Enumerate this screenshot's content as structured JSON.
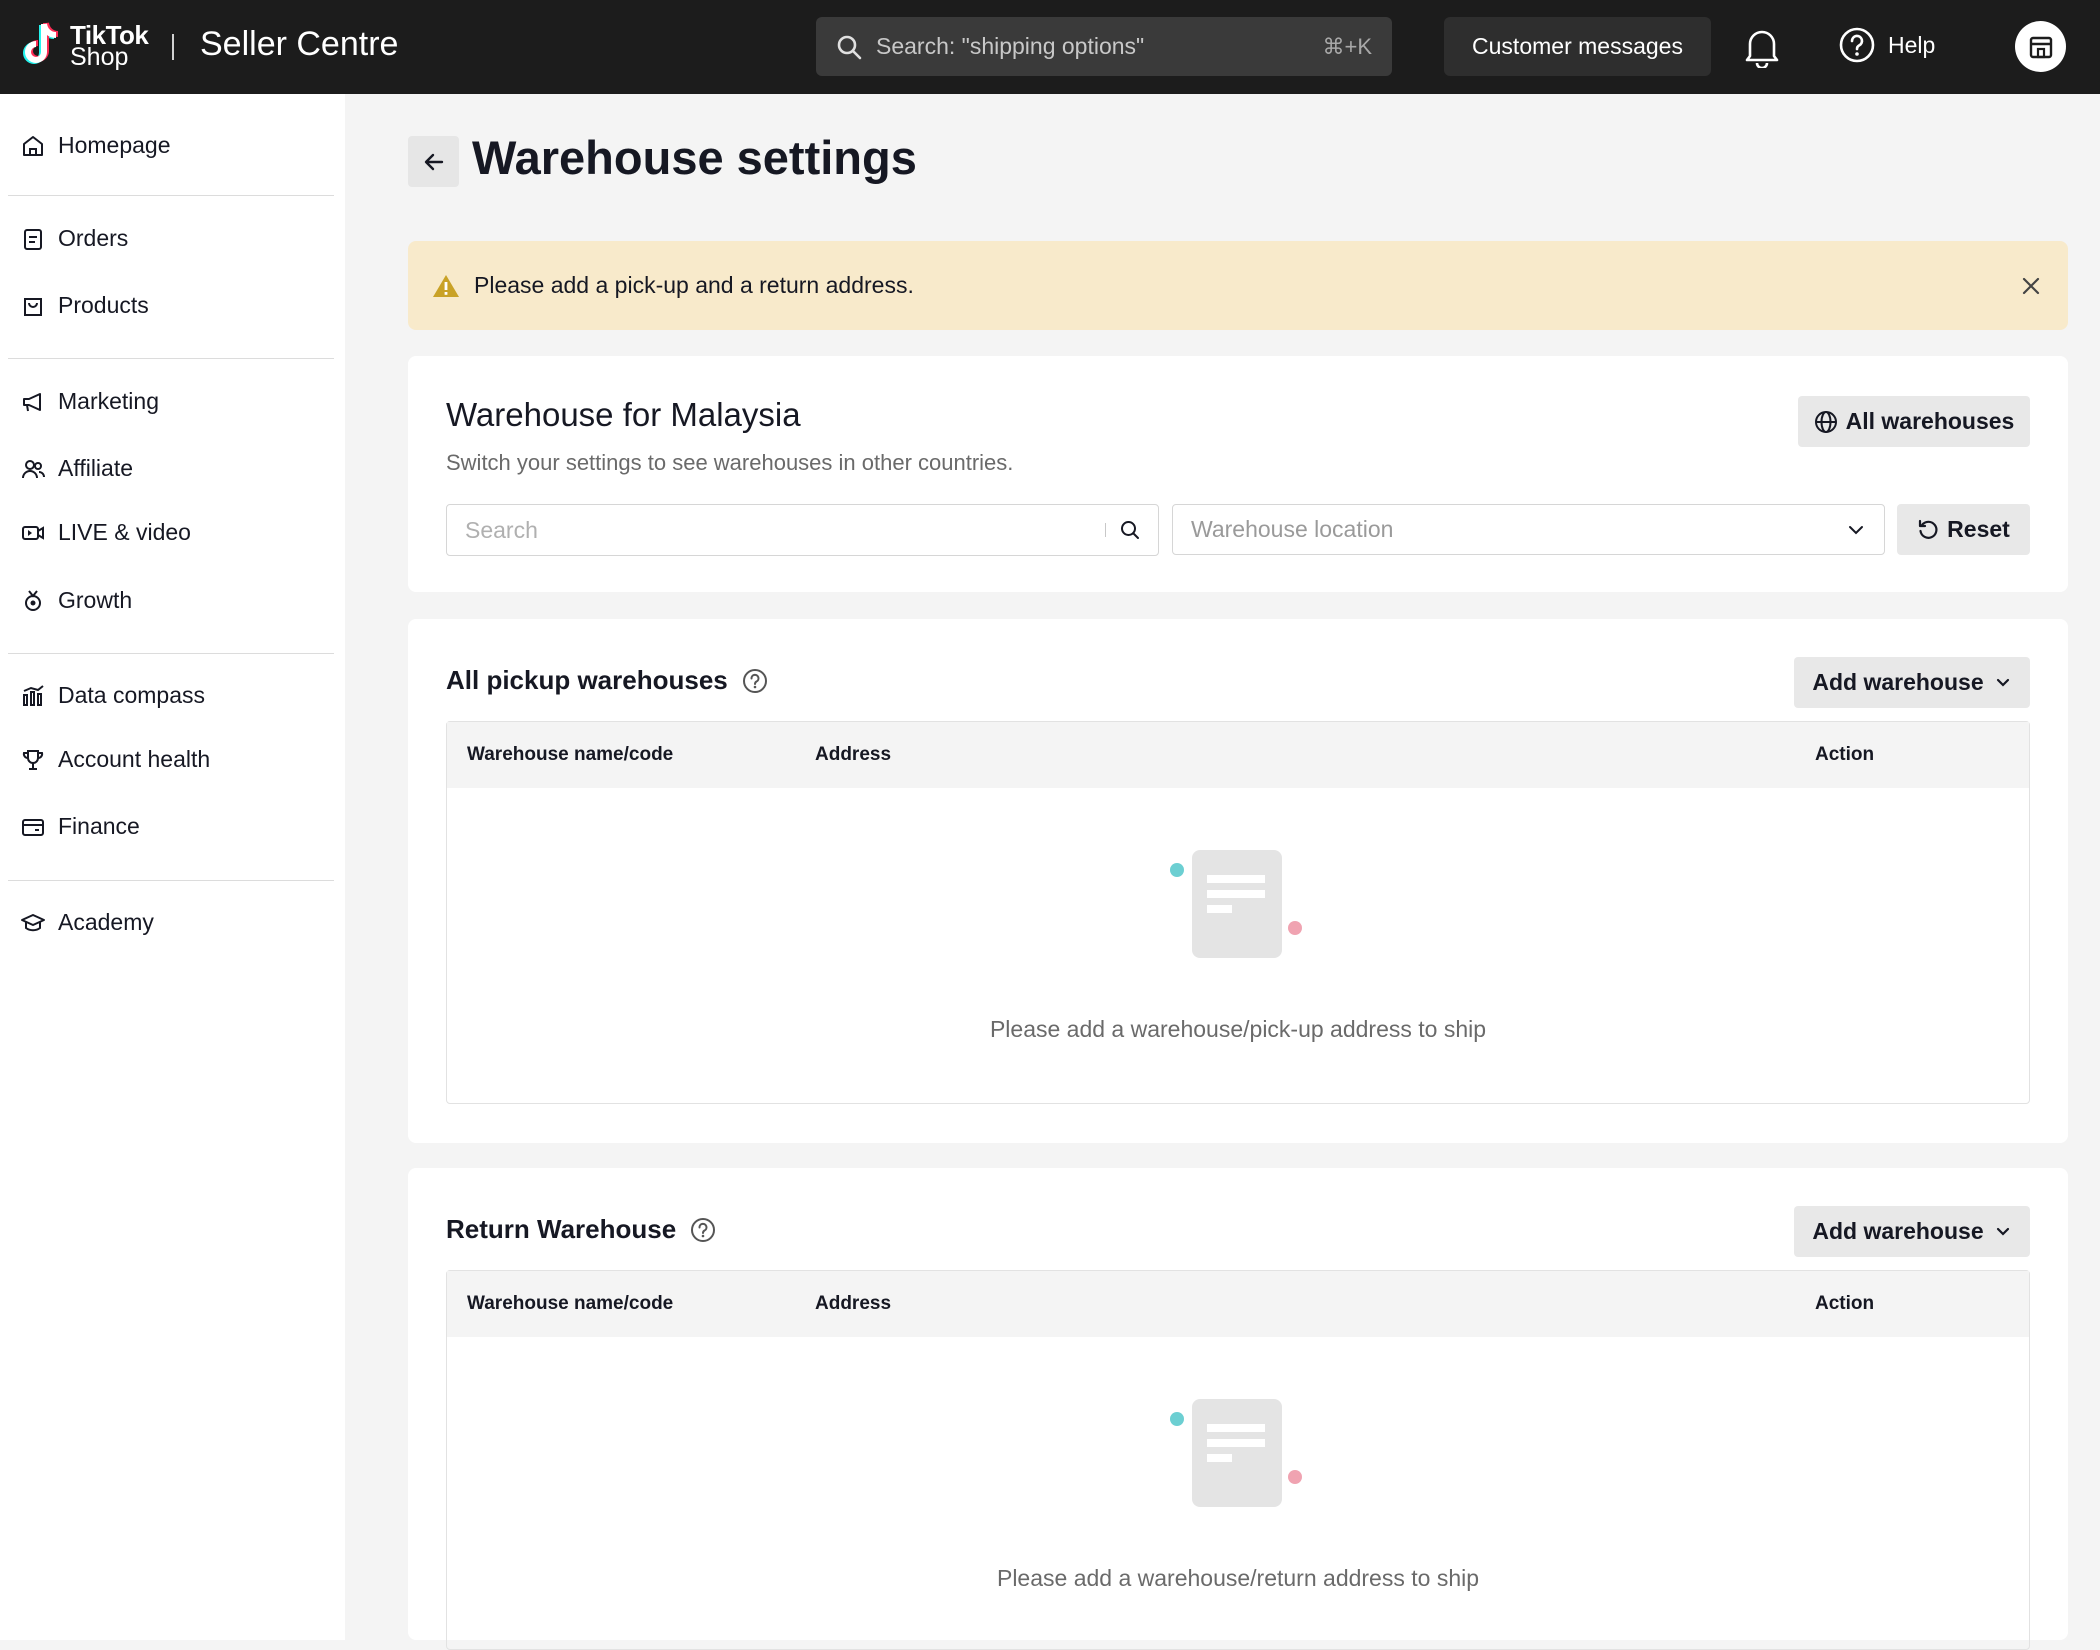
{
  "header": {
    "logo_line1": "TikTok",
    "logo_line2": "Shop",
    "app_title": "Seller Centre",
    "search_placeholder": "Search: \"shipping options\"",
    "search_shortcut": "⌘+K",
    "customer_messages": "Customer messages",
    "help": "Help"
  },
  "sidebar": {
    "items": [
      {
        "label": "Homepage",
        "icon": "home-icon"
      },
      {
        "label": "Orders",
        "icon": "clipboard-icon"
      },
      {
        "label": "Products",
        "icon": "bag-icon"
      },
      {
        "label": "Marketing",
        "icon": "megaphone-icon"
      },
      {
        "label": "Affiliate",
        "icon": "people-icon"
      },
      {
        "label": "LIVE & video",
        "icon": "video-icon"
      },
      {
        "label": "Growth",
        "icon": "medal-icon"
      },
      {
        "label": "Data compass",
        "icon": "bar-chart-icon"
      },
      {
        "label": "Account health",
        "icon": "trophy-icon"
      },
      {
        "label": "Finance",
        "icon": "wallet-icon"
      },
      {
        "label": "Academy",
        "icon": "graduation-cap-icon"
      }
    ]
  },
  "page": {
    "title": "Warehouse settings",
    "alert": "Please add a pick-up and a return address."
  },
  "filter_card": {
    "title": "Warehouse for Malaysia",
    "subtitle": "Switch your settings to see warehouses in other countries.",
    "all_warehouses": "All warehouses",
    "search_placeholder": "Search",
    "location_placeholder": "Warehouse location",
    "reset": "Reset"
  },
  "pickup_section": {
    "title": "All pickup warehouses",
    "add_button": "Add warehouse",
    "columns": [
      "Warehouse name/code",
      "Address",
      "Action"
    ],
    "empty_message": "Please add a warehouse/pick-up address to ship"
  },
  "return_section": {
    "title": "Return Warehouse",
    "add_button": "Add warehouse",
    "columns": [
      "Warehouse name/code",
      "Address",
      "Action"
    ],
    "empty_message": "Please add a warehouse/return address to ship"
  },
  "colors": {
    "topbar": "#1c1c1c",
    "alert_bg": "#f8eacb",
    "warning": "#c9a227",
    "teal_dot": "#6ccfd2",
    "pink_dot": "#f0a3b1"
  }
}
